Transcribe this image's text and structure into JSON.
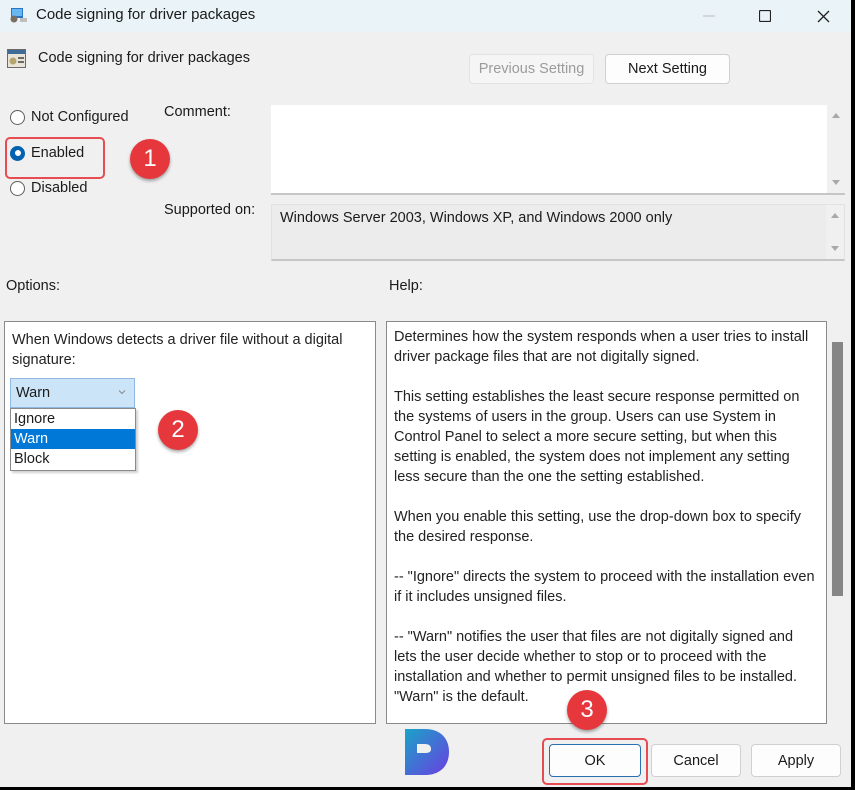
{
  "window": {
    "title": "Code signing for driver packages",
    "controls": {
      "minimize": "minimize",
      "maximize": "maximize",
      "close": "close"
    }
  },
  "header": {
    "policy_name": "Code signing for driver packages",
    "previous_label": "Previous Setting",
    "previous_enabled": false,
    "next_label": "Next Setting"
  },
  "state": {
    "options": [
      {
        "label": "Not Configured",
        "checked": false
      },
      {
        "label": "Enabled",
        "checked": true
      },
      {
        "label": "Disabled",
        "checked": false
      }
    ]
  },
  "comment": {
    "label": "Comment:",
    "value": ""
  },
  "supported": {
    "label": "Supported on:",
    "value": "Windows Server 2003, Windows XP, and Windows 2000 only"
  },
  "options_section": {
    "label": "Options:",
    "prompt": "When Windows detects a driver file without a digital signature:",
    "combo_value": "Warn",
    "dropdown_items": [
      {
        "label": "Ignore",
        "selected": false
      },
      {
        "label": "Warn",
        "selected": true
      },
      {
        "label": "Block",
        "selected": false
      }
    ]
  },
  "help_section": {
    "label": "Help:",
    "paragraphs": [
      "Determines how the system responds when a user tries to install driver package files that are not digitally signed.",
      "This setting establishes the least secure response permitted on the systems of users in the group. Users can use System in Control Panel to select a more secure setting, but when this setting is enabled, the system does not implement any setting less secure than the one the setting established.",
      "When you enable this setting, use the drop-down box to specify the desired response.",
      "--   \"Ignore\" directs the system to proceed with the installation even if it includes unsigned files.",
      "--   \"Warn\" notifies the user that files are not digitally signed and lets the user decide whether to stop or to proceed with the installation and whether to permit unsigned files to be installed. \"Warn\" is the default."
    ]
  },
  "footer": {
    "ok_label": "OK",
    "cancel_label": "Cancel",
    "apply_label": "Apply"
  },
  "annotations": {
    "step1": "1",
    "step2": "2",
    "step3": "3",
    "color": "#e5373c"
  },
  "colors": {
    "accent": "#0078d7",
    "radio_checked": "#0063b1",
    "combo_bg": "#cce4f7",
    "title_bar": "#eaf3f8"
  }
}
